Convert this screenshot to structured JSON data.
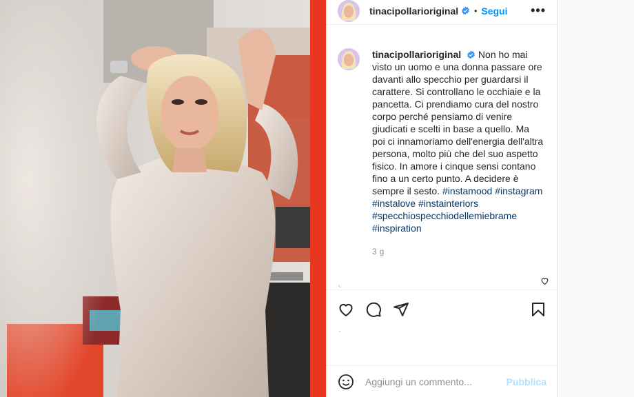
{
  "post": {
    "username": "tinacipollarioriginal",
    "follow_label": "Segui",
    "dot": "•",
    "more": "•••",
    "caption": "Non ho mai visto un uomo e una donna passare ore davanti allo specchio per guardarsi il carattere. Si controllano le occhiaie e la pancetta. Ci prendiamo cura del nostro corpo perché pensiamo di venire giudicati e scelti in base a quello. Ma poi ci innamoriamo dell'energia dell'altra persona, molto più che del suo aspetto fisico. In amore i cinque sensi contano fino a un certo punto. A decidere è sempre il sesto.",
    "hashtags": [
      "#instamood",
      "#instagram",
      "#instalove",
      "#instainteriors",
      "#specchiospecchiodellemiebrame",
      "#inspiration"
    ],
    "age": "3 g",
    "likes_hint": "·"
  },
  "comment": {
    "placeholder": "Aggiungi un commento...",
    "publish_label": "Pubblica"
  },
  "icons": {
    "verified": "verified-badge-icon",
    "like": "heart-icon",
    "comment": "comment-bubble-icon",
    "share": "paper-plane-icon",
    "save": "bookmark-icon",
    "emoji": "smiley-icon",
    "more": "more-options-icon"
  },
  "colors": {
    "accent": "#0095f6",
    "publish_disabled": "#b2dffc",
    "verified": "#3897f0",
    "hashtag": "#00376b",
    "mirror_frame": "#e8371e"
  }
}
